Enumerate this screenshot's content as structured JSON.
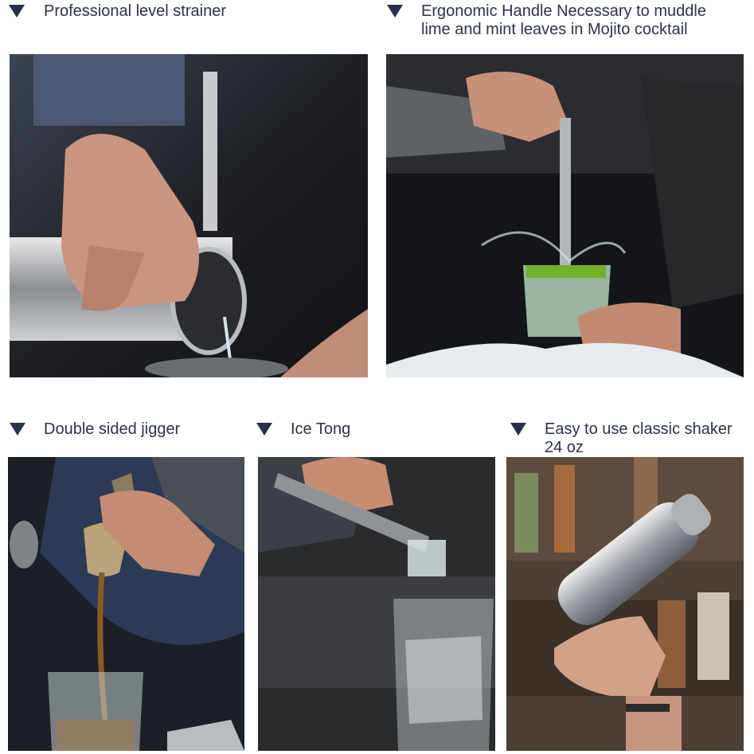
{
  "features": [
    {
      "id": "strainer",
      "caption_lines": [
        "Professional level strainer"
      ],
      "photo": "bartender-pouring-through-strainer"
    },
    {
      "id": "muddler",
      "caption_lines": [
        "Ergonomic Handle Necessary to muddle",
        "lime and mint leaves in Mojito cocktail"
      ],
      "photo": "bartender-muddling-mojito"
    },
    {
      "id": "jigger",
      "caption_lines": [
        "Double sided jigger"
      ],
      "photo": "pouring-from-jigger"
    },
    {
      "id": "tong",
      "caption_lines": [
        "Ice Tong"
      ],
      "photo": "ice-tong-holding-cube"
    },
    {
      "id": "shaker",
      "caption_lines": [
        "Easy to use classic shaker",
        "24 oz"
      ],
      "photo": "hand-holding-shaker"
    }
  ],
  "colors": {
    "marker": "#28304b",
    "caption": "#2d3348",
    "background": "#ffffff"
  },
  "icons": {
    "marker": "down-triangle-icon"
  }
}
